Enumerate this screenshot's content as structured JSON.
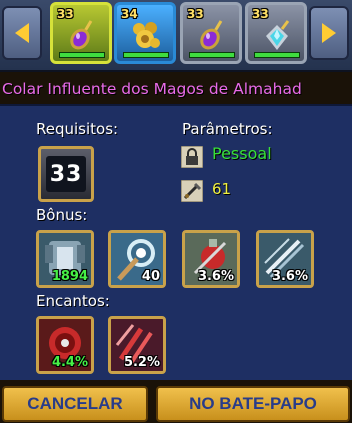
{
  "carousel": {
    "items": [
      {
        "level": "33",
        "icon": "amulet-purple-gem-icon"
      },
      {
        "level": "34",
        "icon": "amulet-gold-chain-icon"
      },
      {
        "level": "33",
        "icon": "amulet-purple-gem-icon"
      },
      {
        "level": "33",
        "icon": "amulet-cyan-crystal-icon"
      }
    ]
  },
  "item": {
    "title": "Colar Influente dos Magos de Almahad"
  },
  "requirements": {
    "label": "Requisitos:",
    "level": "33"
  },
  "parameters": {
    "label": "Parâmetros:",
    "binding": "Pessoal",
    "stat_value": "61"
  },
  "bonus": {
    "label": "Bônus:",
    "items": [
      {
        "icon": "armor-icon",
        "value": "1894"
      },
      {
        "icon": "magic-staff-icon",
        "value": "40"
      },
      {
        "icon": "potion-icon",
        "value": "3.6%"
      },
      {
        "icon": "blades-icon",
        "value": "3.6%"
      }
    ]
  },
  "enchantments": {
    "label": "Encantos:",
    "items": [
      {
        "icon": "red-spiral-icon",
        "value": "4.4%"
      },
      {
        "icon": "claw-strike-icon",
        "value": "5.2%"
      }
    ]
  },
  "buttons": {
    "cancel": "CANCELAR",
    "chat": "NO BATE-PAPO"
  }
}
